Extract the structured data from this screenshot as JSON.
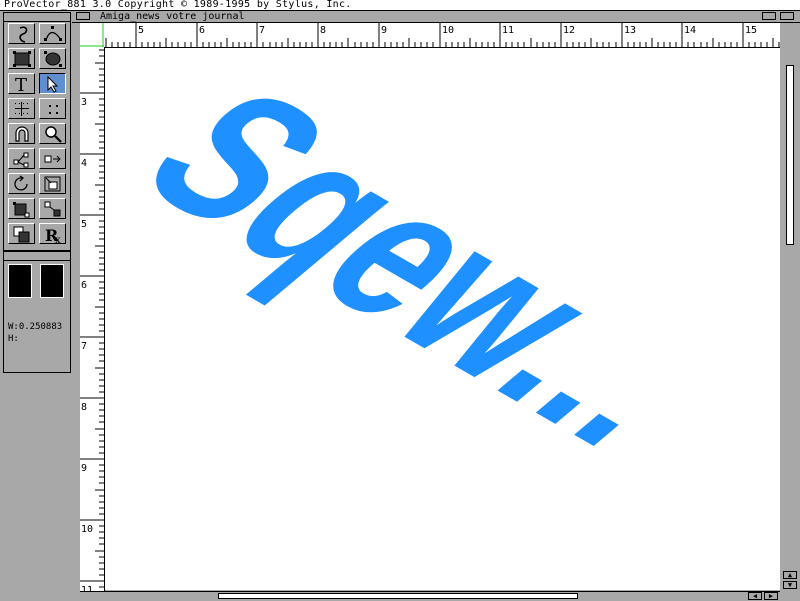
{
  "app": {
    "title": "ProVector_881 3.0 Copyright © 1989-1995 by Stylus, Inc."
  },
  "document": {
    "title": "Amiga_news votre journal",
    "art_text": "Sqew..."
  },
  "rulers": {
    "horizontal": [
      "5",
      "6",
      "7",
      "8",
      "9",
      "10",
      "11",
      "12",
      "13",
      "14",
      "15"
    ],
    "vertical": [
      "3",
      "4",
      "5",
      "6",
      "7",
      "8",
      "9",
      "10",
      "11"
    ]
  },
  "tools": [
    "freehand-icon",
    "bezier-curve-icon",
    "rectangle-icon",
    "ellipse-icon",
    "text-icon",
    "pointer-arrow-icon",
    "grid-icon",
    "points-icon",
    "magnet-icon",
    "magnifier-icon",
    "connect-node-icon",
    "move-node-icon",
    "rotate-icon",
    "scale-icon",
    "transform-icon",
    "reflect-icon",
    "duplicate-icon",
    "prescription-rx-icon"
  ],
  "selected_tool": "pointer-arrow-icon",
  "info_panel": {
    "width_readout": "W:0.250883",
    "height_readout": "H:"
  },
  "colors": {
    "accent": "#5f8fd0",
    "text_fill": "#1e90ff",
    "chrome": "#a8a8a8"
  }
}
